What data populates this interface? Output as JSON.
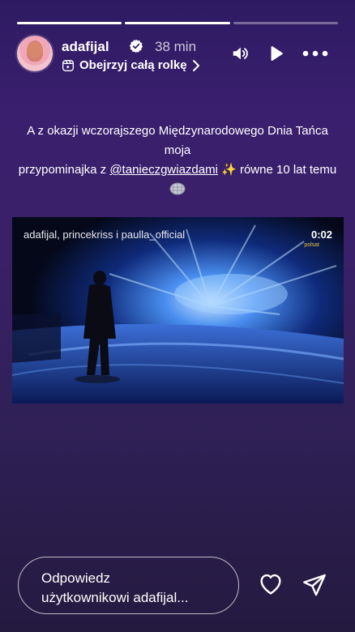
{
  "progress": [
    {
      "fill_percent": 100
    },
    {
      "fill_percent": 100
    },
    {
      "fill_percent": 0
    }
  ],
  "header": {
    "username": "adafijal",
    "time": "38 min",
    "reel_link": "Obejrzyj całą rolkę"
  },
  "caption": {
    "line1": "A z okazji wczorajszego Międzynarodowego Dnia Tańca moja",
    "line2_pre": "przypominajka z ",
    "mention": "@tanieczgwiazdami",
    "line2_post": " ✨ równe 10 lat temu"
  },
  "video": {
    "credits": "adafijal, princekriss i paulla_official",
    "counter": "0:02",
    "channel": "polsat"
  },
  "reply": {
    "placeholder_line1": "Odpowiedz",
    "placeholder_line2": "użytkownikowi adafijal..."
  },
  "colors": {
    "bg_top": "#2e1a63",
    "bg_bottom": "#241a3f",
    "verified": "#ffffff"
  },
  "icons": [
    "verified-icon",
    "reel-icon",
    "chevron-right-icon",
    "volume-icon",
    "play-icon",
    "more-icon",
    "disco-ball-icon",
    "heart-icon",
    "send-icon"
  ]
}
